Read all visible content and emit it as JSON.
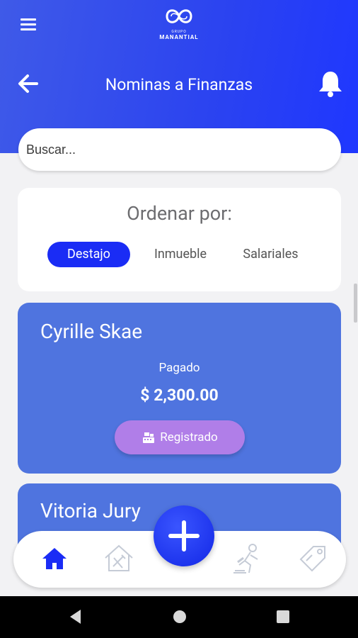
{
  "header": {
    "logo_sub": "GRUPO",
    "logo_name": "MANANTIAL",
    "title": "Nominas a Finanzas"
  },
  "search": {
    "placeholder": "Buscar..."
  },
  "sort": {
    "title": "Ordenar por:",
    "options": [
      {
        "label": "Destajo",
        "active": true
      },
      {
        "label": "Inmueble",
        "active": false
      },
      {
        "label": "Salariales",
        "active": false
      }
    ]
  },
  "cards": [
    {
      "name": "Cyrille Skae",
      "status": "Pagado",
      "amount": "$ 2,300.00",
      "button_label": "Registrado"
    },
    {
      "name": "Vitoria Jury"
    }
  ],
  "bottom_nav": {
    "items": [
      {
        "icon": "home-icon",
        "active": true
      },
      {
        "icon": "house-tools-icon",
        "active": false
      },
      {
        "icon": "worker-icon",
        "active": false
      },
      {
        "icon": "tag-icon",
        "active": false
      }
    ],
    "fab_icon": "plus-icon"
  },
  "colors": {
    "header_gradient_start": "#3f5ae8",
    "header_gradient_end": "#1f37ff",
    "accent": "#1a2cf5",
    "card": "#4f74df",
    "registered_button": "#b07ee8"
  }
}
